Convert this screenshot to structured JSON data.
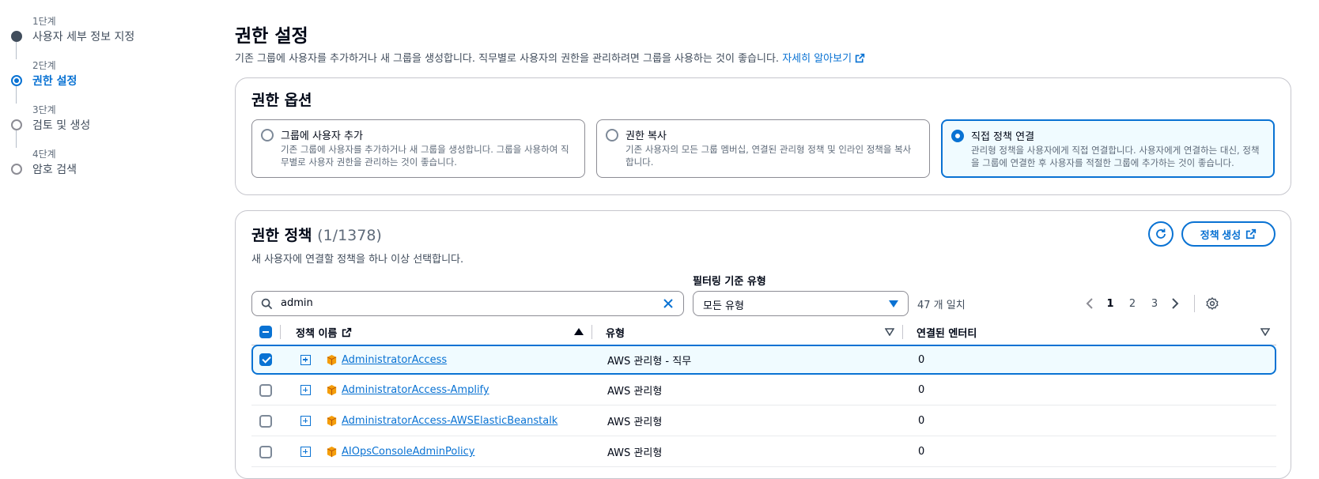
{
  "steps": [
    {
      "num": "1단계",
      "label": "사용자 세부 정보 지정",
      "state": "done"
    },
    {
      "num": "2단계",
      "label": "권한 설정",
      "state": "active"
    },
    {
      "num": "3단계",
      "label": "검토 및 생성",
      "state": "pending"
    },
    {
      "num": "4단계",
      "label": "암호 검색",
      "state": "pending"
    }
  ],
  "header": {
    "title": "권한 설정",
    "description": "기존 그룹에 사용자를 추가하거나 새 그룹을 생성합니다. 직무별로 사용자의 권한을 관리하려면 그룹을 사용하는 것이 좋습니다.",
    "learn_more": "자세히 알아보기"
  },
  "permission_options": {
    "title": "권한 옵션",
    "options": [
      {
        "title": "그룹에 사용자 추가",
        "desc": "기존 그룹에 사용자를 추가하거나 새 그룹을 생성합니다. 그룹을 사용하여 직무별로 사용자 권한을 관리하는 것이 좋습니다.",
        "selected": false
      },
      {
        "title": "권한 복사",
        "desc": "기존 사용자의 모든 그룹 멤버십, 연결된 관리형 정책 및 인라인 정책을 복사합니다.",
        "selected": false
      },
      {
        "title": "직접 정책 연결",
        "desc": "관리형 정책을 사용자에게 직접 연결합니다. 사용자에게 연결하는 대신, 정책을 그룹에 연결한 후 사용자를 적절한 그룹에 추가하는 것이 좋습니다.",
        "selected": true
      }
    ]
  },
  "policies": {
    "title": "권한 정책",
    "count": "(1/1378)",
    "description": "새 사용자에 연결할 정책을 하나 이상 선택합니다.",
    "create_button": "정책 생성",
    "filter_label": "필터링 기준 유형",
    "search_value": "admin",
    "type_value": "모든 유형",
    "matches": "47 개 일치",
    "pages": [
      "1",
      "2",
      "3"
    ],
    "current_page": "1",
    "columns": {
      "name": "정책 이름",
      "type": "유형",
      "entities": "연결된 엔터티"
    },
    "rows": [
      {
        "name": "AdministratorAccess",
        "type": "AWS 관리형 - 직무",
        "entities": "0",
        "checked": true
      },
      {
        "name": "AdministratorAccess-Amplify",
        "type": "AWS 관리형",
        "entities": "0",
        "checked": false
      },
      {
        "name": "AdministratorAccess-AWSElasticBeanstalk",
        "type": "AWS 관리형",
        "entities": "0",
        "checked": false
      },
      {
        "name": "AIOpsConsoleAdminPolicy",
        "type": "AWS 관리형",
        "entities": "0",
        "checked": false
      }
    ]
  },
  "colors": {
    "accent": "#0972d3",
    "policy_icon": "#f59e0b"
  }
}
